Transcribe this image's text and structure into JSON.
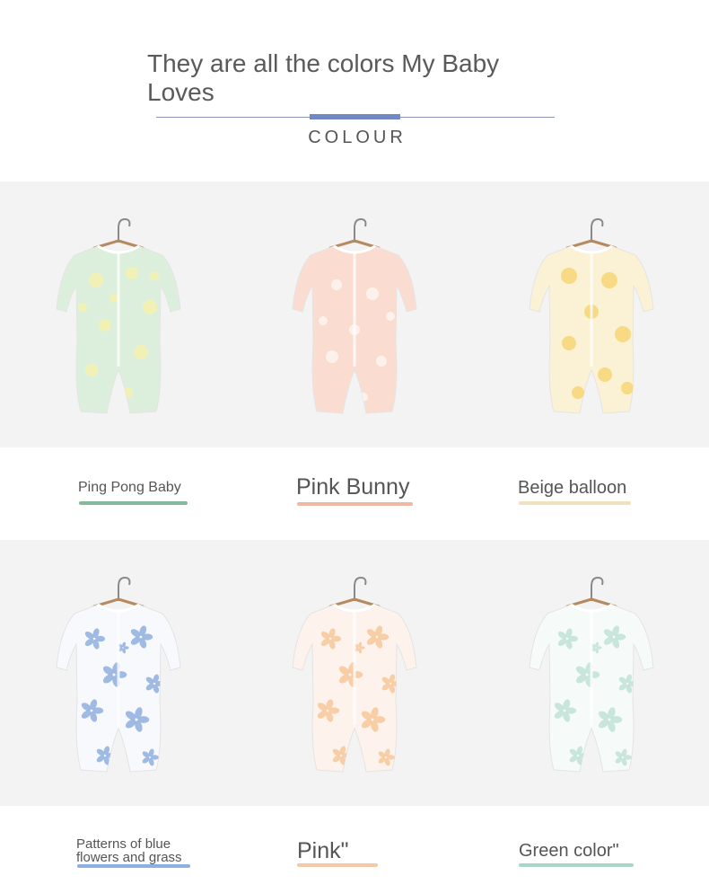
{
  "header": {
    "headline": "They are all the colors My Baby Loves",
    "subtitle": "COLOUR",
    "accent_color": "#7089c4"
  },
  "products": [
    {
      "name": "Ping Pong Baby",
      "base_color": "#dcefdc",
      "print_color": "#f4f1b0",
      "underline_color": "#86b89a",
      "print_pattern": "dots"
    },
    {
      "name": "Pink Bunny",
      "base_color": "#fbdcd0",
      "print_color": "#fdf3ee",
      "underline_color": "#f0b8a4",
      "print_pattern": "bunny"
    },
    {
      "name": "Beige balloon",
      "base_color": "#fbf2d6",
      "print_color": "#f6d77a",
      "underline_color": "#f1e2bf",
      "print_pattern": "balloon"
    },
    {
      "name": "Patterns of blue flowers and grass",
      "base_color": "#f7f9fd",
      "print_color": "#8fb0de",
      "underline_color": "#8fb0de",
      "print_pattern": "flowers"
    },
    {
      "name": "Pink\"",
      "base_color": "#fdf3ec",
      "print_color": "#f7c79a",
      "underline_color": "#f4c9a6",
      "print_pattern": "flowers"
    },
    {
      "name": "Green color\"",
      "base_color": "#f6fbf9",
      "print_color": "#bfe2d6",
      "underline_color": "#a8d7c5",
      "print_pattern": "flowers"
    }
  ]
}
